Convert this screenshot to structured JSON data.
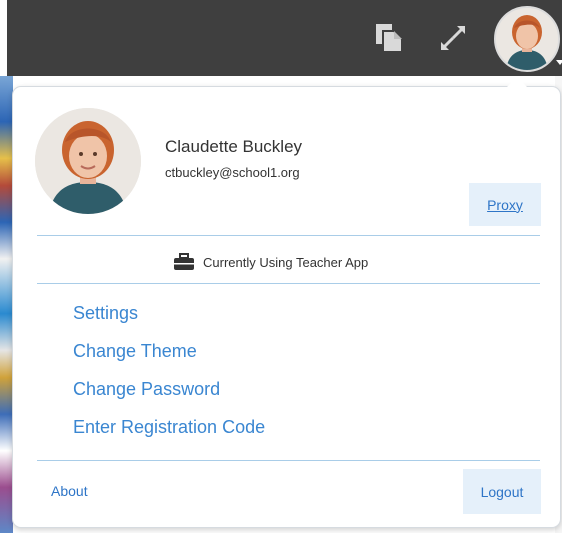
{
  "topbar": {
    "icons": [
      "copy-icon",
      "expand-icon",
      "avatar"
    ]
  },
  "user": {
    "name": "Claudette Buckley",
    "email": "ctbuckley@school1.org",
    "proxy_label": "Proxy"
  },
  "app_status": {
    "icon": "briefcase-icon",
    "text": "Currently Using Teacher App"
  },
  "menu": [
    {
      "label": "Settings"
    },
    {
      "label": "Change Theme"
    },
    {
      "label": "Change Password"
    },
    {
      "label": "Enter Registration Code"
    }
  ],
  "footer": {
    "about_label": "About",
    "logout_label": "Logout"
  },
  "colors": {
    "topbar": "#3f3f3f",
    "link": "#3a86d1",
    "button_bg": "#e5f0fa",
    "divider": "#a9cde8"
  }
}
